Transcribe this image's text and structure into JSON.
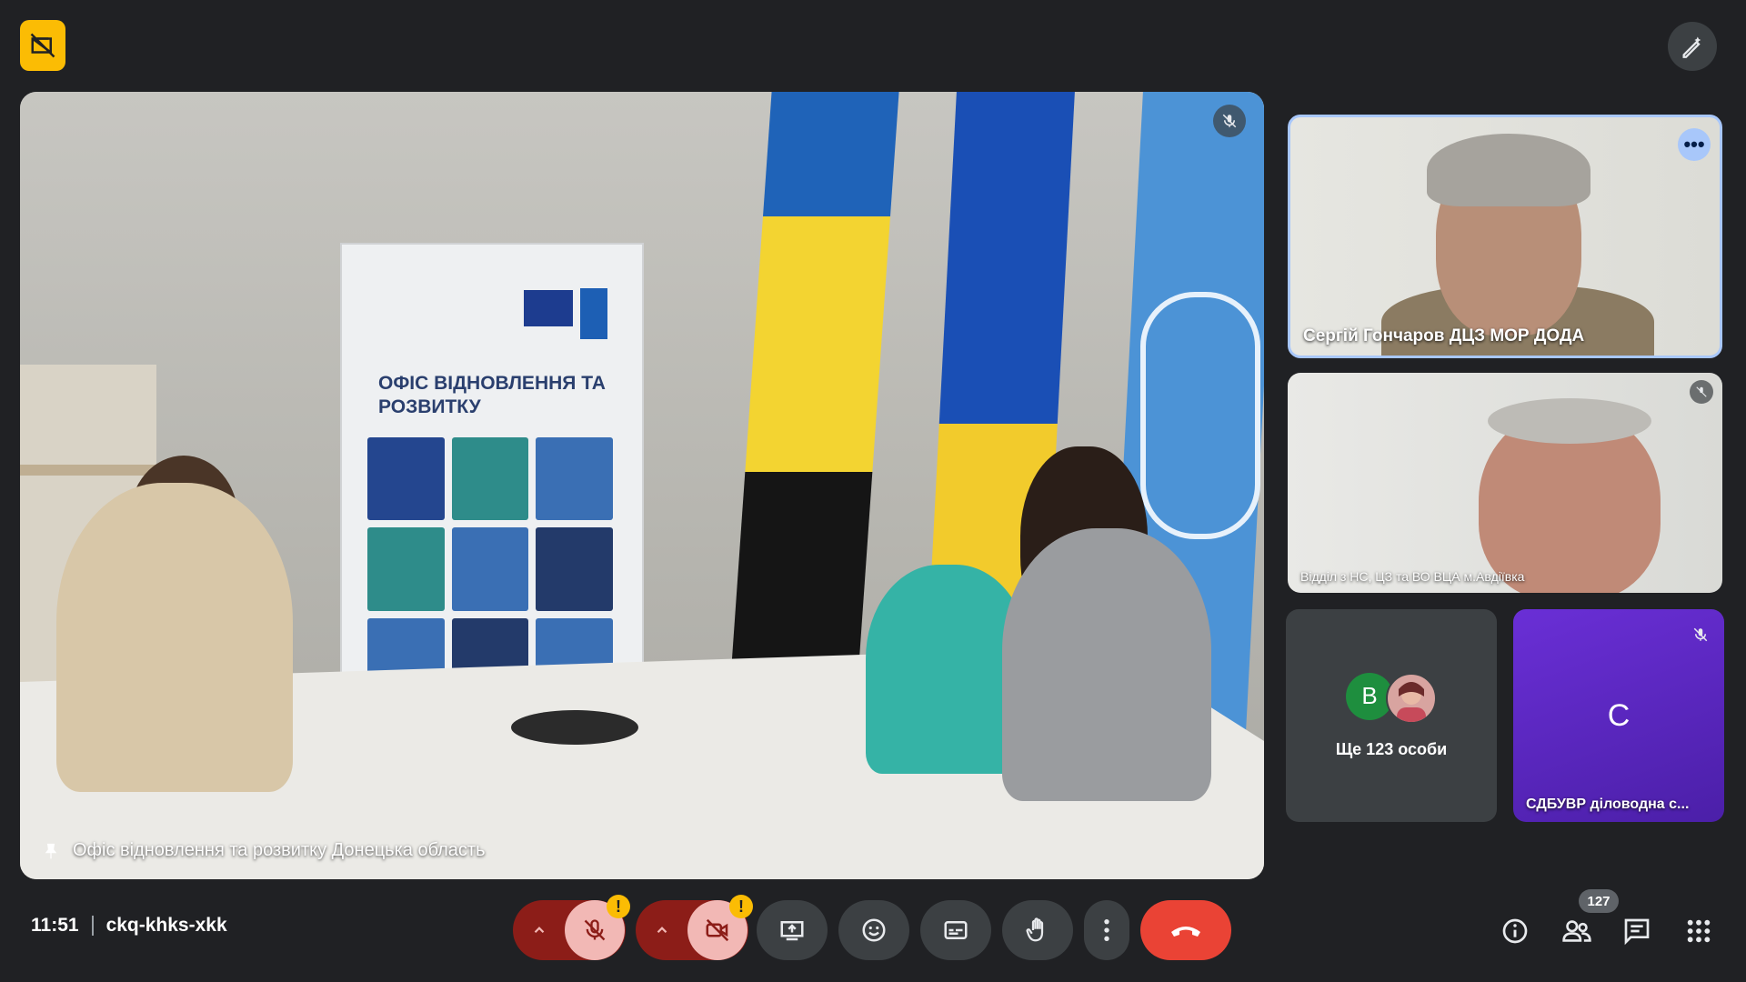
{
  "meeting": {
    "time": "11:51",
    "code": "ckq-khks-xkk",
    "participants_count": "127"
  },
  "main_tile": {
    "name": "Офіс відновлення та розвитку Донецька область",
    "banner_title": "ОФІС ВІДНОВЛЕННЯ ТА РОЗВИТКУ"
  },
  "side_tiles": [
    {
      "name": "Сергій Гончаров ДЦЗ МОР ДОДА"
    },
    {
      "name": "Відділ з НС, ЦЗ та ВО ВЦА м.Авдіївка"
    }
  ],
  "others_tile": {
    "avatar_letter": "В",
    "label": "Ще 123 особи"
  },
  "c_tile": {
    "avatar_letter": "С",
    "name": "СДБУВР діловодна с..."
  },
  "warnings": {
    "mic": "!",
    "cam": "!"
  },
  "colors": {
    "background": "#202124",
    "leave": "#ea4335",
    "warning": "#fbbc04",
    "accent": "#a8c7fa",
    "purple": "#5b25c0"
  }
}
